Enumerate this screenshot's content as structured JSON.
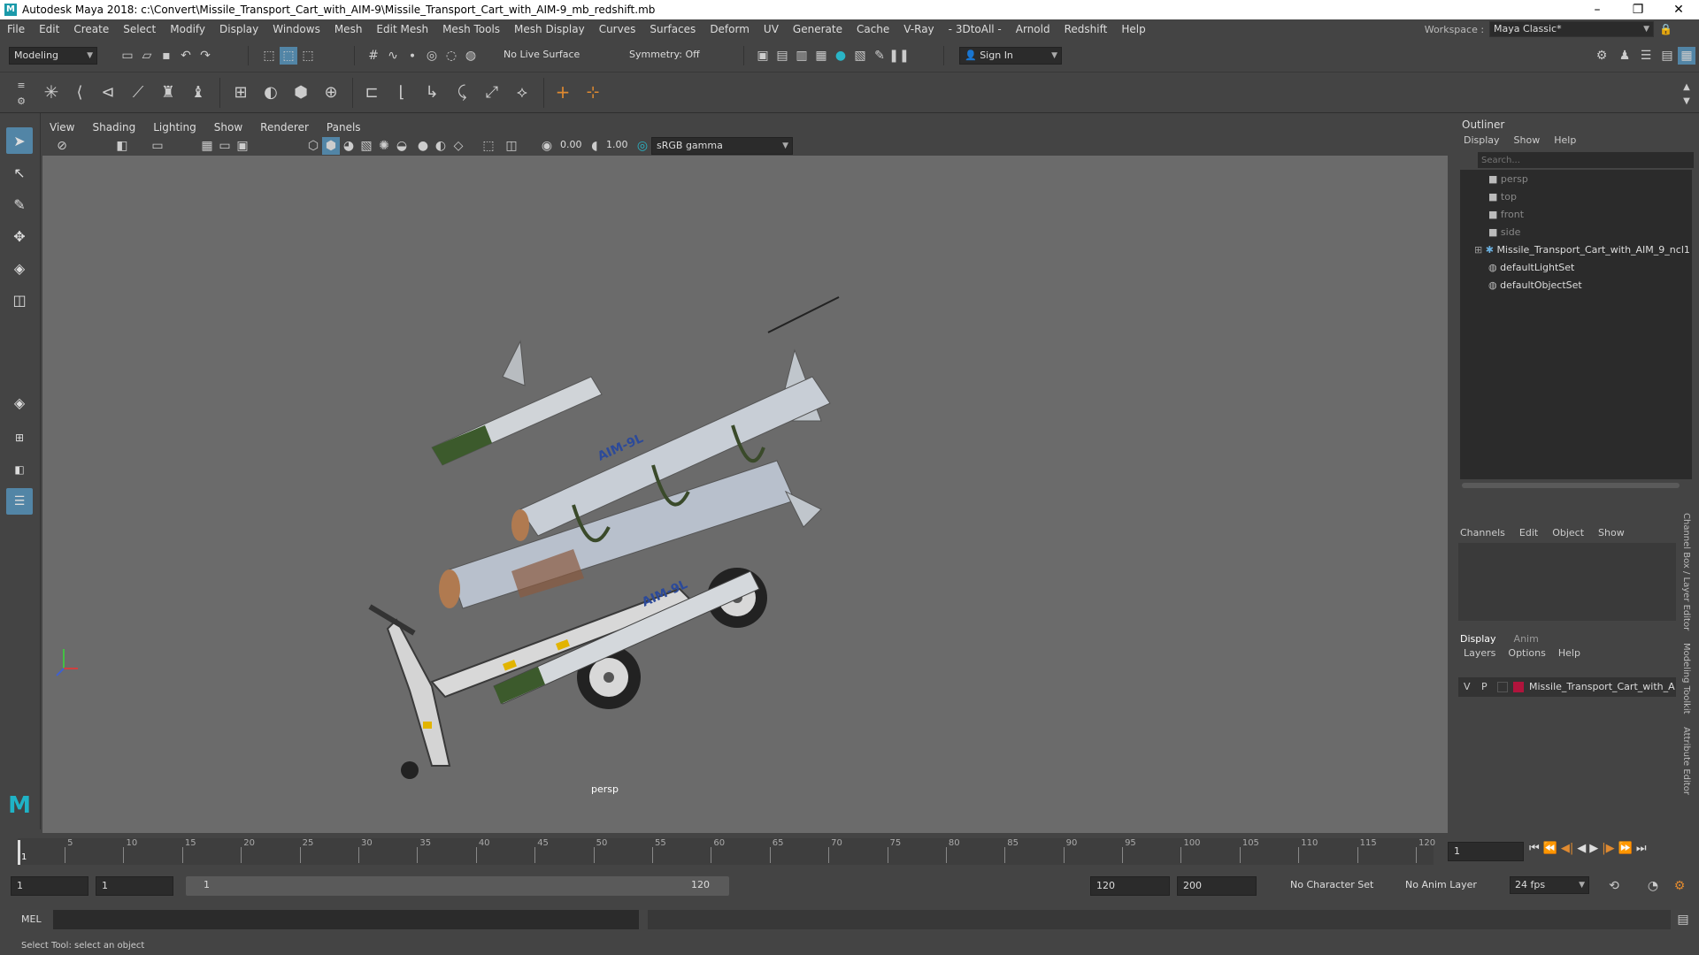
{
  "title_bar": {
    "title": "Autodesk Maya 2018: c:\\Convert\\Missile_Transport_Cart_with_AIM-9\\Missile_Transport_Cart_with_AIM-9_mb_redshift.mb"
  },
  "menu": [
    "File",
    "Edit",
    "Create",
    "Select",
    "Modify",
    "Display",
    "Windows",
    "Mesh",
    "Edit Mesh",
    "Mesh Tools",
    "Mesh Display",
    "Curves",
    "Surfaces",
    "Deform",
    "UV",
    "Generate",
    "Cache",
    "V-Ray",
    "- 3DtoAll -",
    "Arnold",
    "Redshift",
    "Help"
  ],
  "workspace": {
    "label": "Workspace :",
    "value": "Maya Classic*"
  },
  "status_line": {
    "mode": "Modeling",
    "live_surface": "No Live Surface",
    "symmetry": "Symmetry: Off",
    "sign_in": "Sign In"
  },
  "panel_menu": [
    "View",
    "Shading",
    "Lighting",
    "Show",
    "Renderer",
    "Panels"
  ],
  "panel_toolbar": {
    "exposure": "0.00",
    "gamma": "1.00",
    "color_space": "sRGB gamma"
  },
  "viewport": {
    "camera_label": "persp"
  },
  "outliner": {
    "title": "Outliner",
    "menu": [
      "Display",
      "Show",
      "Help"
    ],
    "search_placeholder": "Search...",
    "items": [
      {
        "label": "persp",
        "type": "camera"
      },
      {
        "label": "top",
        "type": "camera"
      },
      {
        "label": "front",
        "type": "camera"
      },
      {
        "label": "side",
        "type": "camera"
      },
      {
        "label": "Missile_Transport_Cart_with_AIM_9_ncl1",
        "type": "group"
      },
      {
        "label": "defaultLightSet",
        "type": "set"
      },
      {
        "label": "defaultObjectSet",
        "type": "set"
      }
    ]
  },
  "channel_box": {
    "menu": [
      "Channels",
      "Edit",
      "Object",
      "Show"
    ]
  },
  "layer_editor": {
    "tabs": [
      "Display",
      "Anim"
    ],
    "menu": [
      "Layers",
      "Options",
      "Help"
    ],
    "layer": {
      "v": "V",
      "p": "P",
      "name": "Missile_Transport_Cart_with_A",
      "color": "#b0143c"
    }
  },
  "side_tabs": [
    "Channel Box / Layer Editor",
    "Modeling Toolkit",
    "Attribute Editor"
  ],
  "timeline": {
    "ticks": [
      "5",
      "10",
      "15",
      "20",
      "25",
      "30",
      "35",
      "40",
      "45",
      "50",
      "55",
      "60",
      "65",
      "70",
      "75",
      "80",
      "85",
      "90",
      "95",
      "100",
      "105",
      "110",
      "115",
      "120"
    ],
    "start_marker": "1",
    "current_frame": "1"
  },
  "range": {
    "start": "1",
    "anim_start": "1",
    "slider_start": "1",
    "slider_end": "120",
    "anim_end": "120",
    "end": "200",
    "character_set": "No Character Set",
    "anim_layer": "No Anim Layer",
    "fps": "24 fps"
  },
  "command_line": {
    "label": "MEL"
  },
  "help_line": "Select Tool: select an object"
}
